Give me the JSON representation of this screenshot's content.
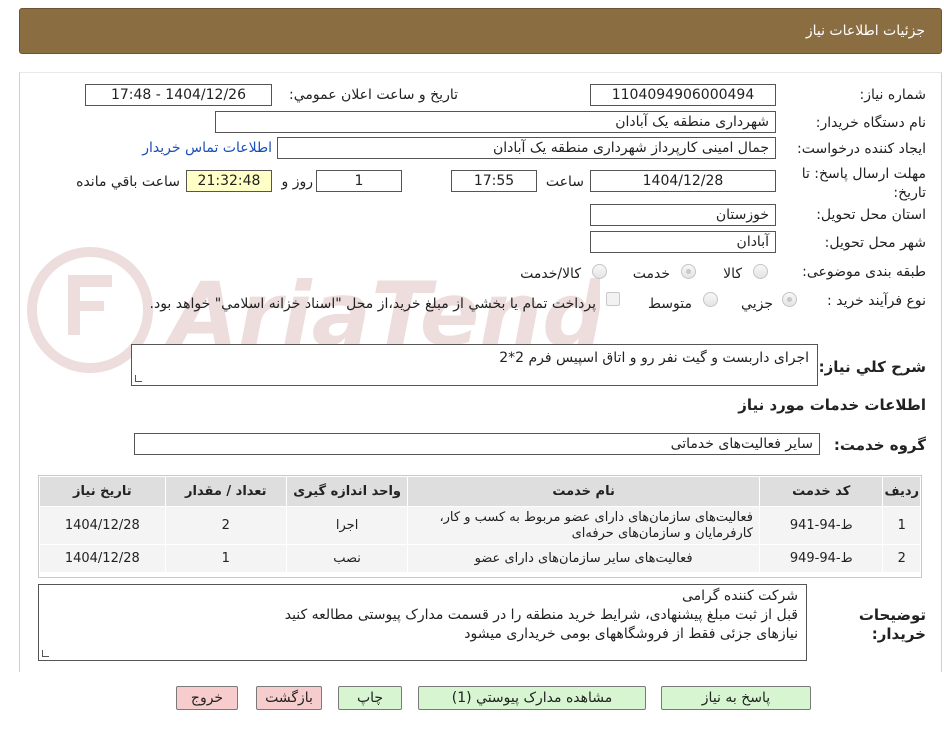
{
  "header": {
    "title": "جزئیات اطلاعات نیاز"
  },
  "labels": {
    "need_number": "شماره نیاز:",
    "announce_datetime": "تاریخ و ساعت اعلان عمومي:",
    "buyer_org": "نام دستگاه خريدار:",
    "requester": "ايجاد کننده درخواست:",
    "deadline": "مهلت ارسال پاسخ: تا تاریخ:",
    "time": "ساعت",
    "day_and": "روز و",
    "remaining": "ساعت باقي مانده",
    "province": "استان محل تحویل:",
    "city": "شهر محل تحویل:",
    "category": "طبقه بندی موضوعی:",
    "process_type": "نوع فرآیند خرید :",
    "summary": "شرح کلي نياز:",
    "services_info": "اطلاعات خدمات مورد نیاز",
    "service_group": "گروه خدمت:",
    "buyer_notes": "توضیحات خریدار:"
  },
  "values": {
    "need_number": "1104094906000494",
    "announce_datetime": "1404/12/26 - 17:48",
    "buyer_org": "شهرداری منطقه یک آبادان",
    "requester": "جمال امینی کارپرداز شهرداری منطقه یک آبادان",
    "contact_link": "اطلاعات تماس خریدار",
    "deadline_date": "1404/12/28",
    "deadline_time": "17:55",
    "days": "1",
    "remaining_time": "21:32:48",
    "province": "خوزستان",
    "city": "آبادان",
    "summary": "اجرای داربست و گیت نفر رو و اتاق اسپیس فرم 2*2",
    "service_group": "سایر فعالیت‌های خدماتی",
    "buyer_notes_lines": [
      "شرکت کننده گرامی",
      "قبل از ثبت مبلغ پیشنهادی، شرایط خرید منطقه را در قسمت مدارک پیوستی مطالعه کنید",
      "نیازهای جزئی فقط از فروشگاههای بومی خریداری میشود"
    ]
  },
  "category_options": [
    {
      "label": "کالا",
      "selected": false
    },
    {
      "label": "خدمت",
      "selected": true
    },
    {
      "label": "کالا/خدمت",
      "selected": false
    }
  ],
  "process_options": [
    {
      "label": "جزيي",
      "selected": true
    },
    {
      "label": "متوسط",
      "selected": false
    }
  ],
  "payment_note": "پرداخت تمام يا بخشي از مبلغ خريد،از محل \"اسناد خزانه اسلامي\" خواهد بود.",
  "table": {
    "headers": [
      "ردیف",
      "کد خدمت",
      "نام خدمت",
      "واحد اندازه گیری",
      "تعداد / مقدار",
      "تاریخ نیاز"
    ],
    "rows": [
      [
        "1",
        "ط-94-941",
        "فعالیت‌های سازمان‌های دارای عضو مربوط به کسب و کار، کارفرمایان و سازمان‌های حرفه‌ای",
        "اجرا",
        "2",
        "1404/12/28"
      ],
      [
        "2",
        "ط-94-949",
        "فعالیت‌های سایر سازمان‌های دارای عضو",
        "نصب",
        "1",
        "1404/12/28"
      ]
    ]
  },
  "buttons": {
    "reply": "پاسخ به نیاز",
    "view_docs": "مشاهده مدارک پيوستي (1)",
    "print": "چاپ",
    "back": "بازگشت",
    "exit": "خروج"
  },
  "watermark": {
    "text": "AriaTender.neT"
  },
  "colors": {
    "header_bg": "#8b6d42",
    "link": "#1a4fb5",
    "remaining_bg": "#ffffc6",
    "green_btn": "#d6f5d0",
    "pink_btn": "#f7cccc"
  }
}
